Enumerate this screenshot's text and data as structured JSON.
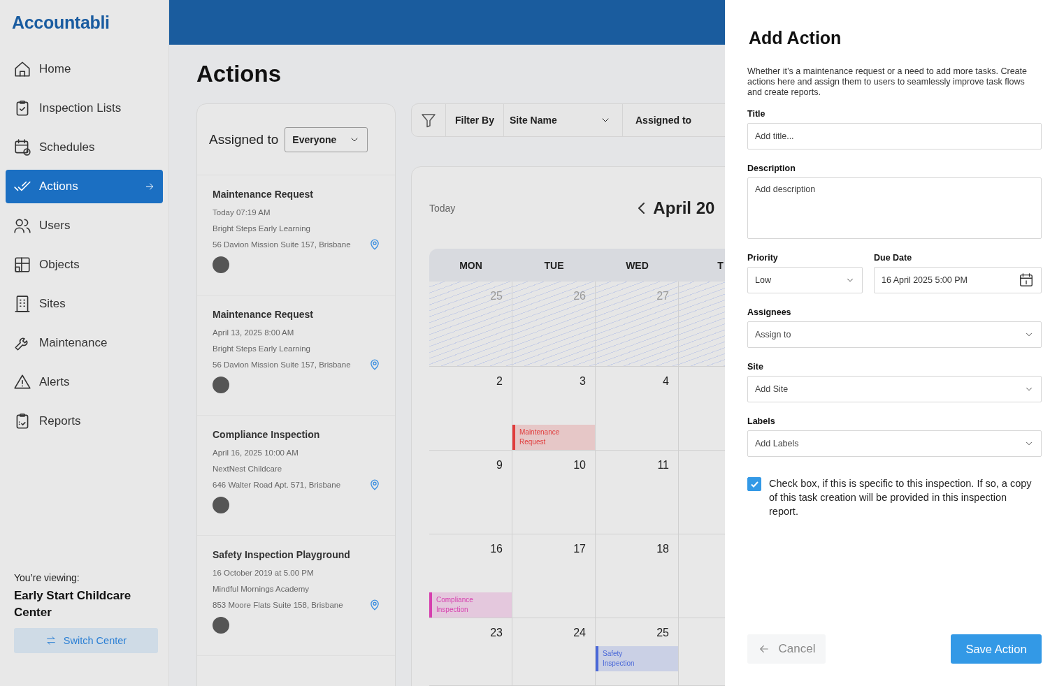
{
  "sidebar": {
    "logo": "Accountabli",
    "items": [
      {
        "label": "Home",
        "selected": false
      },
      {
        "label": "Inspection Lists",
        "selected": false
      },
      {
        "label": "Schedules",
        "selected": false
      },
      {
        "label": "Actions",
        "selected": true
      },
      {
        "label": "Users",
        "selected": false
      },
      {
        "label": "Objects",
        "selected": false
      },
      {
        "label": "Sites",
        "selected": false
      },
      {
        "label": "Maintenance",
        "selected": false
      },
      {
        "label": "Alerts",
        "selected": false
      },
      {
        "label": "Reports",
        "selected": false
      }
    ],
    "viewing_label": "You’re viewing:",
    "center_name": "Early Start Childcare Center",
    "switch_button": "Switch Center"
  },
  "page": {
    "title": "Actions"
  },
  "action_list": {
    "assigned_label": "Assigned to",
    "assigned_value": "Everyone",
    "items": [
      {
        "title": "Maintenance Request",
        "time": "Today 07:19 AM",
        "site": "Bright Steps Early Learning",
        "address": "56 Davion Mission Suite 157, Brisbane"
      },
      {
        "title": "Maintenance Request",
        "time": "April 13, 2025 8:00 AM",
        "site": "Bright Steps Early Learning",
        "address": "56 Davion Mission Suite 157, Brisbane"
      },
      {
        "title": "Compliance Inspection",
        "time": "April 16, 2025 10:00 AM",
        "site": "NextNest Childcare",
        "address": "646 Walter Road Apt. 571, Brisbane"
      },
      {
        "title": "Safety Inspection Playground",
        "time": "16 October 2019 at 5.00 PM",
        "site": "Mindful Mornings Academy",
        "address": "853 Moore Flats Suite 158, Brisbane"
      }
    ]
  },
  "filter_bar": {
    "label": "Filter By",
    "site_select": "Site Name",
    "assigned_select": "Assigned to"
  },
  "calendar": {
    "today_button": "Today",
    "month": "April 20",
    "weekdays": [
      "MON",
      "TUE",
      "WED",
      "T"
    ],
    "weeks": [
      {
        "days": [
          {
            "date": "25",
            "outside": true
          },
          {
            "date": "26",
            "outside": true
          },
          {
            "date": "27",
            "outside": true
          },
          {
            "outside": true
          }
        ]
      },
      {
        "days": [
          {
            "date": "2",
            "outside": false
          },
          {
            "date": "3",
            "outside": false,
            "event": {
              "title": "Maintenance Request",
              "color": "#e03b3b"
            }
          },
          {
            "date": "4",
            "outside": false
          },
          {
            "outside": false
          }
        ]
      },
      {
        "days": [
          {
            "date": "9",
            "outside": false
          },
          {
            "date": "10",
            "outside": false
          },
          {
            "date": "11",
            "outside": false
          },
          {
            "outside": false
          }
        ]
      },
      {
        "days": [
          {
            "date": "16",
            "outside": false,
            "event": {
              "title": "Compliance Inspection",
              "color": "#d63fae"
            }
          },
          {
            "date": "17",
            "outside": false
          },
          {
            "date": "18",
            "outside": false
          },
          {
            "outside": false
          }
        ]
      },
      {
        "days": [
          {
            "date": "23",
            "outside": false
          },
          {
            "date": "24",
            "outside": false
          },
          {
            "date": "25",
            "outside": false,
            "event": {
              "title": "Safety Inspection",
              "color": "#4a68d8"
            }
          },
          {
            "outside": false
          }
        ]
      }
    ]
  },
  "drawer": {
    "title": "Add Action",
    "description": "Whether it’s a maintenance request or a need to add more tasks. Create actions here and assign them to users to seamlessly improve task flows and create reports.",
    "title_field": {
      "label": "Title",
      "placeholder": "Add title..."
    },
    "description_field": {
      "label": "Description",
      "placeholder": "Add description"
    },
    "priority_field": {
      "label": "Priority",
      "value": "Low"
    },
    "due_date_field": {
      "label": "Due Date",
      "value": "16 April 2025 5:00 PM"
    },
    "assignees_field": {
      "label": "Assignees",
      "placeholder": "Assign to"
    },
    "site_field": {
      "label": "Site",
      "placeholder": "Add Site"
    },
    "labels_field": {
      "label": "Labels",
      "placeholder": "Add Labels"
    },
    "checkbox": {
      "checked": true,
      "label": "Check box, if this is specific to this inspection. If so, a copy of this task creation will be provided in this inspection report."
    },
    "cancel_button": "Cancel",
    "save_button": "Save Action"
  }
}
